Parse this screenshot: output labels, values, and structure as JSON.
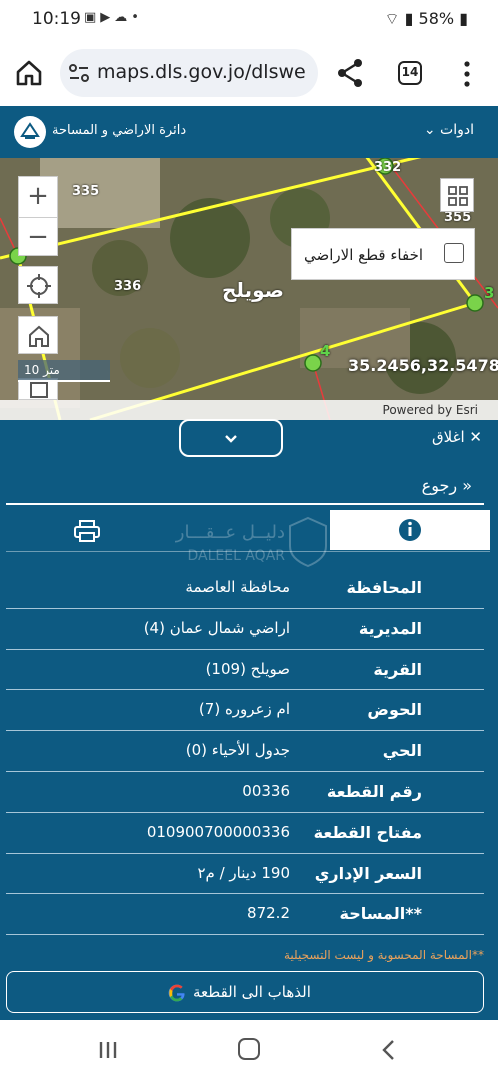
{
  "status_bar": {
    "time": "10:19",
    "notification_icons": "image-icon youtube-icon weather-icon dot",
    "battery": "58%"
  },
  "browser": {
    "url": "maps.dls.gov.jo/dlswe",
    "tab_count": "14"
  },
  "app_header": {
    "department_name": "دائرة الاراضي و المساحة",
    "tools_label": "ادوات",
    "brand_color": "#0d5a82"
  },
  "map": {
    "hide_parcels_label": "اخفاء قطع الاراضي",
    "scale_label": "10 متر",
    "coordinates": "35.2456,32.5478",
    "attribution": "Powered by Esri",
    "parcel_labels": [
      "335",
      "336",
      "332",
      "355"
    ],
    "vertex_labels": [
      "4",
      "3"
    ],
    "place_name": "صويلح"
  },
  "panel": {
    "close_label": "اغلاق",
    "back_label": "رجوع",
    "watermark_line1": "دليــل عــقـــار",
    "watermark_line2": "DALEEL AQAR",
    "rows": [
      {
        "label": "المحافظة",
        "value": "محافظة العاصمة"
      },
      {
        "label": "المديرية",
        "value": "اراضي شمال عمان (4)"
      },
      {
        "label": "القرية",
        "value": "صويلح (109)"
      },
      {
        "label": "الحوض",
        "value": "ام زعروره (7)"
      },
      {
        "label": "الحي",
        "value": "جدول الأحياء (0)"
      },
      {
        "label": "رقم القطعة",
        "value": "00336"
      },
      {
        "label": "مفتاح القطعة",
        "value": "010900700000336"
      },
      {
        "label": "السعر الإداري",
        "value": "190 دينار / م٢"
      },
      {
        "label": "**المساحة",
        "value": "872.2"
      }
    ],
    "note": "**المساحة المحسوبة و ليست التسجيلية",
    "goto_label": "الذهاب الى القطعة",
    "note_color": "#e9a25c"
  }
}
